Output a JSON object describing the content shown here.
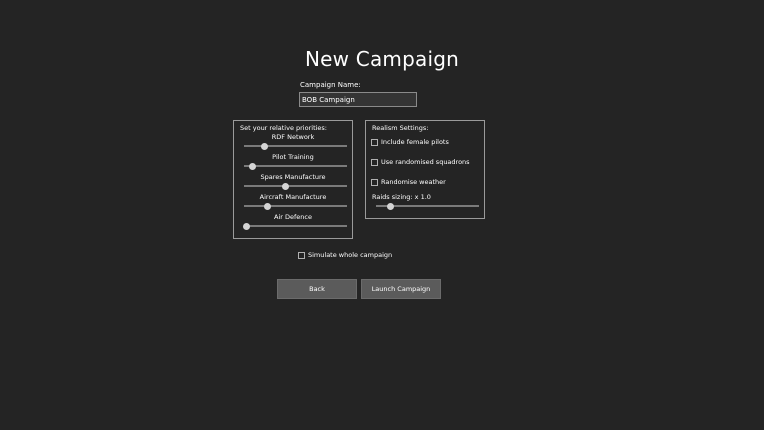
{
  "page": {
    "title": "New Campaign"
  },
  "campaign_name": {
    "label": "Campaign Name:",
    "value": "BOB Campaign"
  },
  "priorities": {
    "heading": "Set your relative priorities:",
    "sliders": [
      {
        "label": "RDF Network",
        "value": 0.2
      },
      {
        "label": "Pilot Training",
        "value": 0.08
      },
      {
        "label": "Spares Manufacture",
        "value": 0.4
      },
      {
        "label": "Aircraft Manufacture",
        "value": 0.23
      },
      {
        "label": "Air Defence",
        "value": 0.02
      }
    ]
  },
  "realism": {
    "heading": "Realism Settings:",
    "options": [
      {
        "label": "Include female pilots",
        "checked": false
      },
      {
        "label": "Use randomised squadrons",
        "checked": false
      },
      {
        "label": "Randomise weather",
        "checked": false
      }
    ],
    "raids_sizing": {
      "label": "Raids sizing: x 1.0",
      "value": 0.14
    }
  },
  "simulate": {
    "label": "Simulate whole campaign",
    "checked": false
  },
  "buttons": {
    "back": "Back",
    "launch": "Launch Campaign"
  },
  "colors": {
    "background": "#242424",
    "panel_border": "#9a9a9a",
    "button": "#5b5b5b",
    "thumb": "#d4d4d4"
  }
}
